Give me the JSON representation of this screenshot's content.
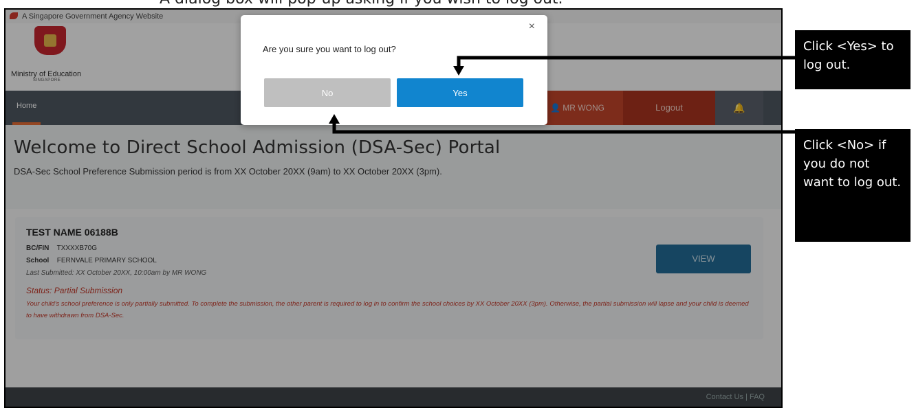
{
  "doc_caption": "A dialog box will pop-up asking if you wish to log out.",
  "gov_banner": "A Singapore Government Agency Website",
  "brand": {
    "name": "Ministry of Education",
    "sub": "SINGAPORE"
  },
  "nav": {
    "home": "Home",
    "user": "MR WONG",
    "logout": "Logout",
    "bell_icon": "bell-icon"
  },
  "hero": {
    "title": "Welcome to Direct School Admission (DSA-Sec) Portal",
    "period": "DSA-Sec School Preference Submission period is from XX October 20XX (9am) to XX October 20XX (3pm)."
  },
  "card": {
    "student_name": "TEST NAME 06188B",
    "bc_label": "BC/FIN",
    "bc_value": "TXXXXB70G",
    "school_label": "School",
    "school_value": "FERNVALE PRIMARY SCHOOL",
    "last_submitted": "Last Submitted:  XX October 20XX,  10:00am by MR WONG",
    "status": "Status: Partial Submission",
    "note": "Your child's school preference is only partially submitted. To complete the submission, the other parent is required to log in to confirm the school choices by XX October 20XX (3pm). Otherwise, the partial submission will lapse and your child is deemed to have withdrawn from DSA-Sec.",
    "view_button": "VIEW"
  },
  "footer": {
    "contact": "Contact Us",
    "sep": "|",
    "faq": "FAQ"
  },
  "modal": {
    "question": "Are you sure you want to log out?",
    "no": "No",
    "yes": "Yes",
    "close": "×"
  },
  "callouts": {
    "yes": "Click <Yes> to log out.",
    "no": "Click <No> if you do not want to log out."
  },
  "colors": {
    "yes_button": "#1185cf",
    "no_button": "#bfbfbf",
    "logout_bg": "#a83420",
    "status": "#c0392b"
  }
}
